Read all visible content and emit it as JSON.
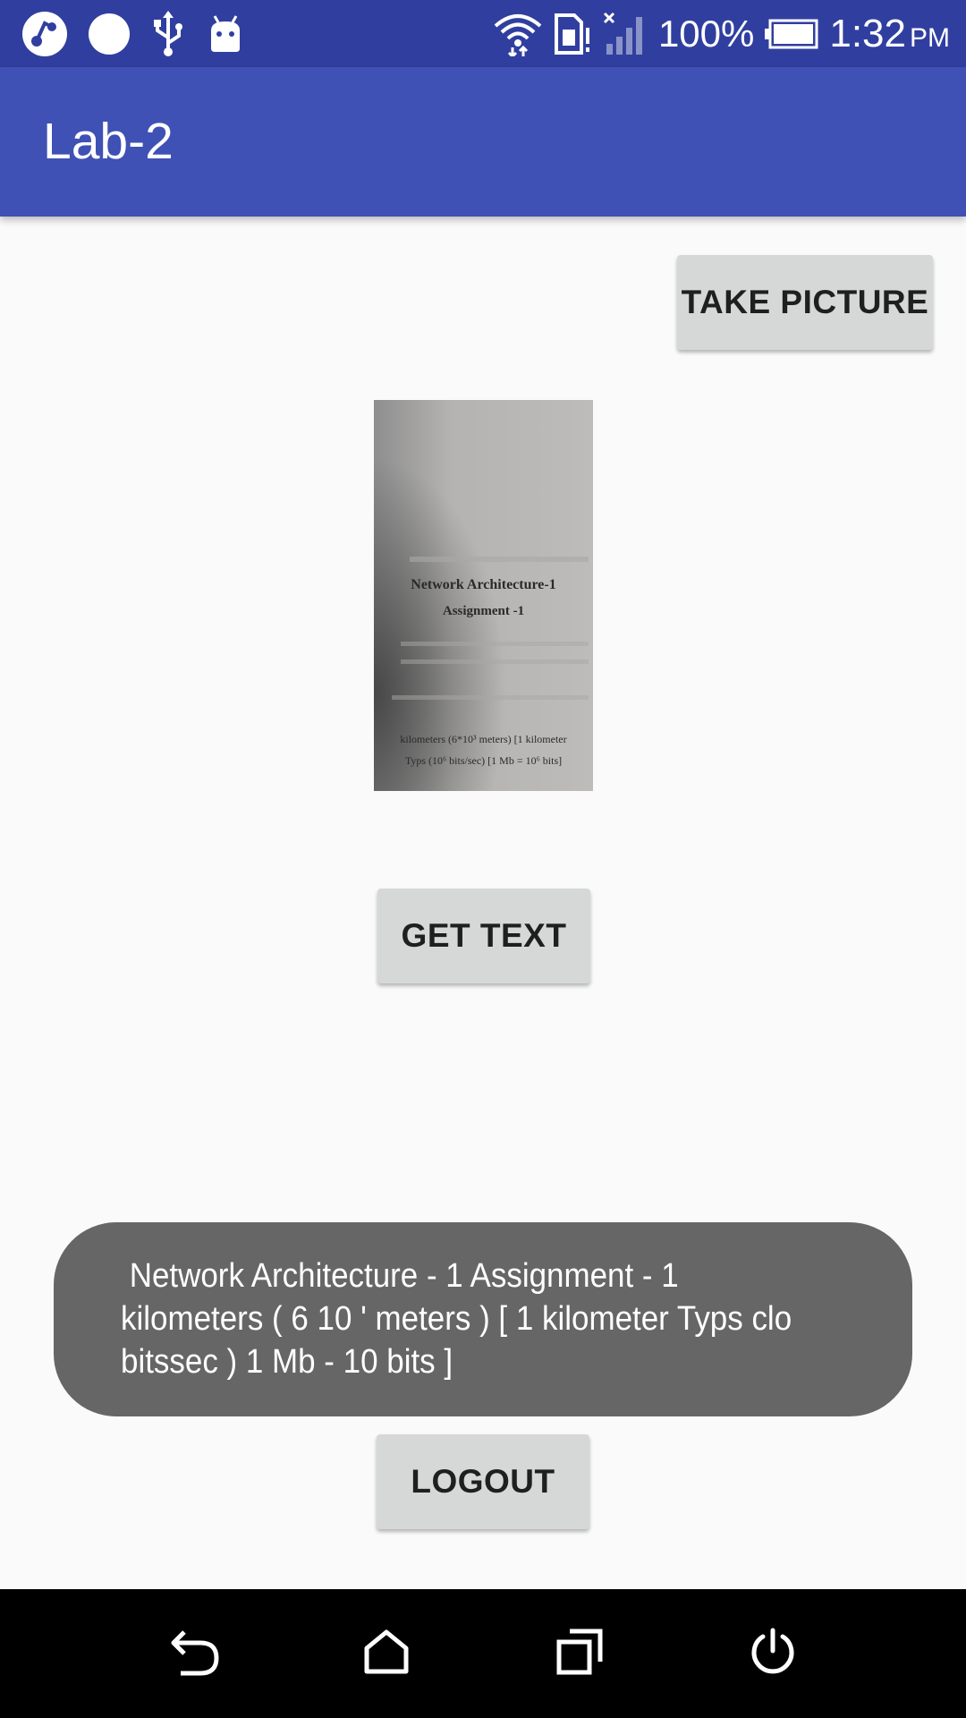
{
  "status_bar": {
    "battery_percent": "100%",
    "time": "1:32",
    "ampm": "PM",
    "icons": [
      "app-icon",
      "circle-notification-icon",
      "usb-icon",
      "android-debug-icon",
      "wifi-icon",
      "sim-card-icon",
      "signal-icon",
      "battery-icon"
    ]
  },
  "app_bar": {
    "title": "Lab-2"
  },
  "buttons": {
    "take_picture": "TAKE PICTURE",
    "get_text": "GET TEXT",
    "logout": "LOGOUT"
  },
  "photo": {
    "line1": "Network Architecture-1",
    "line2": "Assignment -1",
    "line3": "kilometers (6*10³ meters) [1 kilometer",
    "line4": "Typs (10⁶ bits/sec) [1 Mb = 10⁶ bits]"
  },
  "toast": {
    "message": " Network Architecture - 1 Assignment - 1\nkilometers ( 6 10 ' meters ) [ 1 kilometer Typs clo\nbitssec ) 1 Mb - 10 bits ]"
  },
  "nav_bar": {
    "icons": [
      "back-icon",
      "home-icon",
      "recents-icon",
      "power-icon"
    ]
  }
}
